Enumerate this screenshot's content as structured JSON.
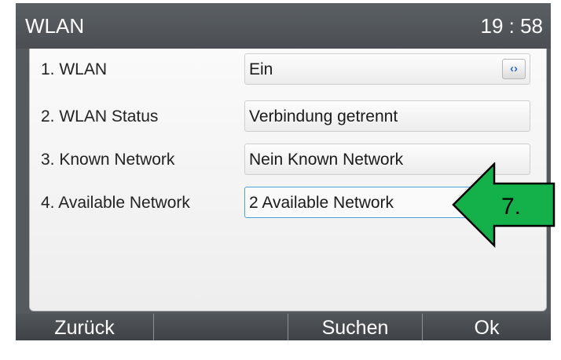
{
  "title": "WLAN",
  "clock": "19 : 58",
  "rows": [
    {
      "label": "1.  WLAN",
      "value": "Ein",
      "toggle": true
    },
    {
      "label": "2.  WLAN Status",
      "value": "Verbindung getrennt"
    },
    {
      "label": "3.  Known Network",
      "value": "Nein Known Network"
    },
    {
      "label": "4.  Available Network",
      "value": "2 Available Network",
      "focused": true
    }
  ],
  "softkeys": [
    "Zurück",
    "",
    "Suchen",
    "Ok"
  ],
  "annotation": {
    "label": "7.",
    "color": "#14b04a",
    "icon": "arrow-left-icon"
  },
  "toggle_icon": "switch-arrows-icon",
  "colors": {
    "accent": "#4aa3d8",
    "frame": "#555a5f"
  }
}
